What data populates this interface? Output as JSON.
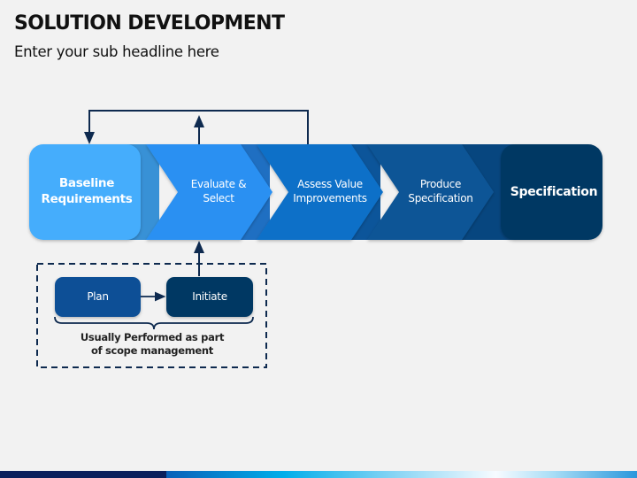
{
  "header": {
    "title": "SOLUTION DEVELOPMENT",
    "subtitle": "Enter your sub headline here"
  },
  "process": {
    "steps": [
      {
        "label": "Baseline Requirements",
        "color": "#44adfc"
      },
      {
        "label": "Evaluate & Select",
        "color": "#2b90f2"
      },
      {
        "label": "Assess Value Improvements",
        "color": "#0f70c8"
      },
      {
        "label": "Produce Specification",
        "color": "#0b5596"
      },
      {
        "label": "Specification",
        "color": "#053863"
      }
    ],
    "band_colors": [
      "#3891d6",
      "#1f6fc2",
      "#0c559a",
      "#07467f"
    ]
  },
  "scope": {
    "boxes": [
      {
        "label": "Plan",
        "color": "#0b4f96"
      },
      {
        "label": "Initiate",
        "color": "#053863"
      }
    ],
    "caption": "Usually Performed as part of scope management"
  },
  "colors": {
    "line": "#0e2a4f",
    "background": "#f2f2f2"
  }
}
